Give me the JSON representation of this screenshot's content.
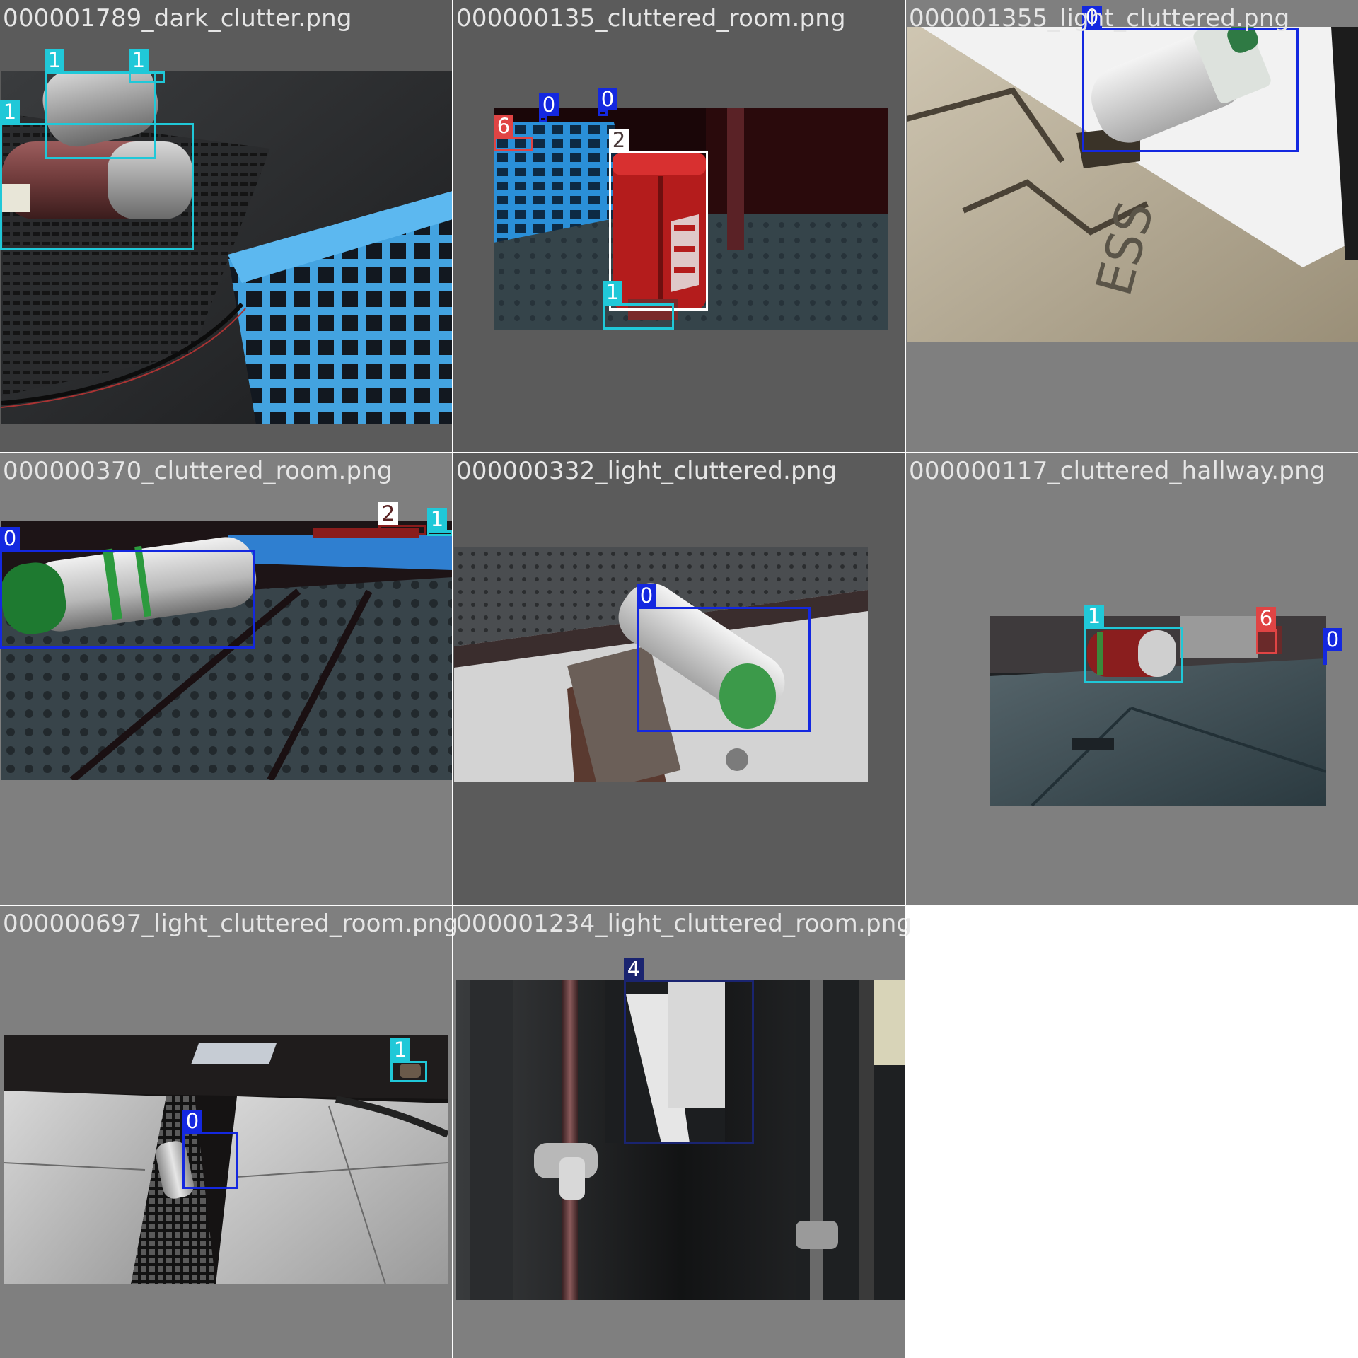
{
  "mosaic": {
    "class_colors": {
      "0": "#1428e0",
      "1": "#20c8d8",
      "2": "#ffffff",
      "4": "#1a2470",
      "6": "#e04444"
    },
    "tiles": [
      {
        "filename": "000001789_dark_clutter.png",
        "detections": [
          {
            "class_label": "1"
          },
          {
            "class_label": "1"
          },
          {
            "class_label": "1"
          }
        ]
      },
      {
        "filename": "000000135_cluttered_room.png",
        "detections": [
          {
            "class_label": "0"
          },
          {
            "class_label": "0"
          },
          {
            "class_label": "6"
          },
          {
            "class_label": "2"
          },
          {
            "class_label": "1"
          }
        ]
      },
      {
        "filename": "000001355_light_cluttered.png",
        "detections": [
          {
            "class_label": "0"
          }
        ]
      },
      {
        "filename": "000000370_cluttered_room.png",
        "detections": [
          {
            "class_label": "0"
          },
          {
            "class_label": "2"
          },
          {
            "class_label": "1"
          }
        ]
      },
      {
        "filename": "000000332_light_cluttered.png",
        "detections": [
          {
            "class_label": "0"
          }
        ]
      },
      {
        "filename": "000000117_cluttered_hallway.png",
        "detections": [
          {
            "class_label": "1"
          },
          {
            "class_label": "6"
          },
          {
            "class_label": "0"
          }
        ]
      },
      {
        "filename": "000000697_light_cluttered_room.png",
        "detections": [
          {
            "class_label": "1"
          },
          {
            "class_label": "0"
          }
        ]
      },
      {
        "filename": "000001234_light_cluttered_room.png",
        "detections": [
          {
            "class_label": "4"
          }
        ]
      }
    ]
  }
}
